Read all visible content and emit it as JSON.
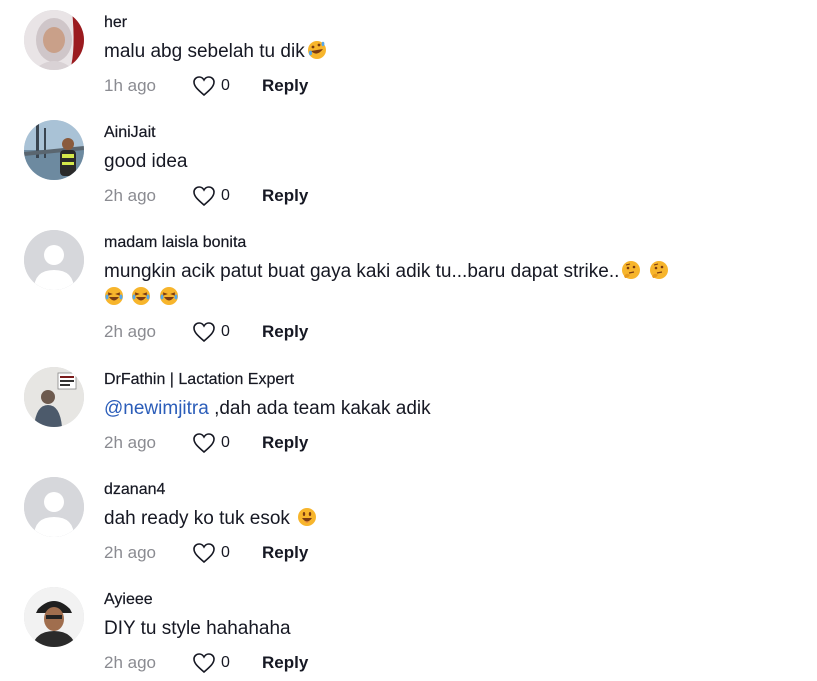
{
  "comments": [
    {
      "username": "her",
      "text_parts": [
        "malu abg sebelah tu dik"
      ],
      "emojis": [
        "rofl-emoji"
      ],
      "time": "1h ago",
      "likes": "0",
      "reply": "Reply"
    },
    {
      "username": "AiniJait",
      "text_parts": [
        "good idea"
      ],
      "emojis": [],
      "time": "2h ago",
      "likes": "0",
      "reply": "Reply"
    },
    {
      "username": "madam laisla bonita",
      "text_parts": [
        "mungkin acik patut buat gaya kaki adik tu...baru dapat strike.."
      ],
      "emojis": [
        "thinking-emoji",
        "thinking-emoji",
        "laughing-emoji",
        "laughing-emoji",
        "laughing-emoji"
      ],
      "time": "2h ago",
      "likes": "0",
      "reply": "Reply"
    },
    {
      "username": "DrFathin | Lactation Expert",
      "mention": "@newimjitra",
      "text_parts": [
        " ,dah ada team kakak adik"
      ],
      "emojis": [],
      "time": "2h ago",
      "likes": "0",
      "reply": "Reply"
    },
    {
      "username": "dzanan4",
      "text_parts": [
        "dah ready ko tuk esok "
      ],
      "emojis": [
        "grin-emoji"
      ],
      "time": "2h ago",
      "likes": "0",
      "reply": "Reply"
    },
    {
      "username": "Ayieee",
      "text_parts": [
        "DIY tu style hahahaha"
      ],
      "emojis": [],
      "time": "2h ago",
      "likes": "0",
      "reply": "Reply"
    }
  ],
  "colors": {
    "text": "#161823",
    "muted": "#8a8b91",
    "mention": "#2b5db9",
    "avatar_placeholder": "#d6d7db"
  }
}
